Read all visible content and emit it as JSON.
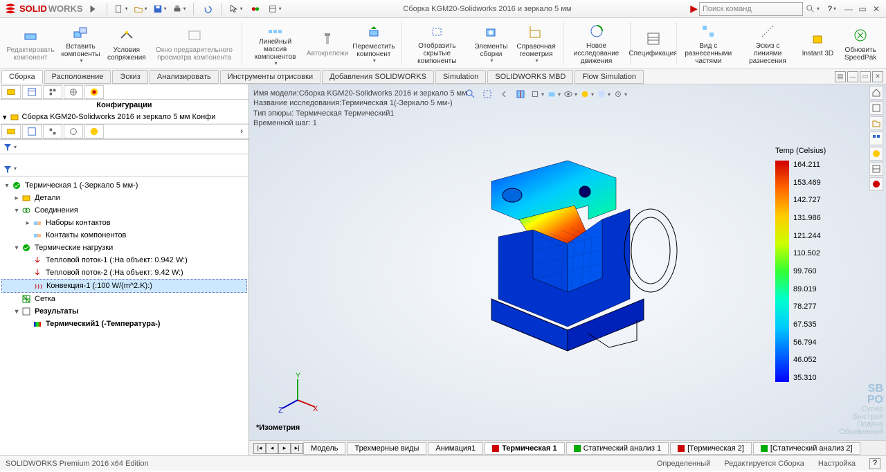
{
  "brand1": "SOLID",
  "brand2": "WORKS",
  "window_title": "Сборка KGM20-Solidworks 2016 и зеркало 5 мм",
  "search_placeholder": "Поиск команд",
  "ribbon": [
    {
      "label": "Редактировать компонент"
    },
    {
      "label": "Вставить компоненты"
    },
    {
      "label": "Условия сопряжения"
    },
    {
      "label": "Окно предварительного просмотра компонента"
    },
    {
      "label": "Линейный массив компонентов"
    },
    {
      "label": "Автокрепежи"
    },
    {
      "label": "Переместить компонент"
    },
    {
      "label": "Отобразить скрытые компоненты"
    },
    {
      "label": "Элементы сборки"
    },
    {
      "label": "Справочная геометрия"
    },
    {
      "label": "Новое исследование движения"
    },
    {
      "label": "Спецификация"
    },
    {
      "label": "Вид с разнесенными частями"
    },
    {
      "label": "Эскиз с линиями разнесения"
    },
    {
      "label": "Instant 3D"
    },
    {
      "label": "Обновить SpeedPak"
    }
  ],
  "ribbon_tabs": [
    "Сборка",
    "Расположение",
    "Эскиз",
    "Анализировать",
    "Инструменты отрисовки",
    "Добавления SOLIDWORKS",
    "Simulation",
    "SOLIDWORKS MBD",
    "Flow Simulation"
  ],
  "config_title": "Конфигурации",
  "config_item": "Сборка KGM20-Solidworks 2016 и зеркало 5 мм Конфи",
  "tree": {
    "study": "Термическая 1 (-Зеркало 5 мм-)",
    "parts": "Детали",
    "connections": "Соединения",
    "contact_sets": "Наборы контактов",
    "component_contacts": "Контакты компонентов",
    "thermal_loads": "Термические нагрузки",
    "heat1": "Тепловой поток-1 (:На объект: 0.942 W:)",
    "heat2": "Тепловой поток-2 (:На объект: 9.42 W:)",
    "convection": "Конвекция-1 (:100 W/(m^2.K):)",
    "mesh": "Сетка",
    "results": "Результаты",
    "thermal1": "Термический1 (-Температура-)"
  },
  "vp_info": {
    "l1": "Имя модели:Сборка KGM20-Solidworks 2016 и зеркало 5 мм",
    "l2": "Название исследования:Термическая 1(-Зеркало 5 мм-)",
    "l3": "Тип эпюры: Термическая Термический1",
    "l4": "Временной шаг: 1"
  },
  "legend_title": "Temp (Celsius)",
  "legend_values": [
    "164.211",
    "153.469",
    "142.727",
    "131.986",
    "121.244",
    "110.502",
    "99.760",
    "89.019",
    "78.277",
    "67.535",
    "56.794",
    "46.052",
    "35.310"
  ],
  "isometry": "*Изометрия",
  "triad": {
    "x": "X",
    "y": "Y",
    "z": "Z"
  },
  "bottom_tabs": [
    "Модель",
    "Трехмерные виды",
    "Анимация1",
    "Термическая 1",
    "Статический анализ 1",
    "[Термическая 2]",
    "[Статический анализ 2]"
  ],
  "status": {
    "edition": "SOLIDWORKS Premium 2016 x64 Edition",
    "s1": "Определенный",
    "s2": "Редактируется Сборка",
    "s3": "Настройка"
  },
  "watermark": {
    "l1": "Супер",
    "l2": "Быстрая",
    "l3": "Подача",
    "l4": "Объявлений"
  }
}
